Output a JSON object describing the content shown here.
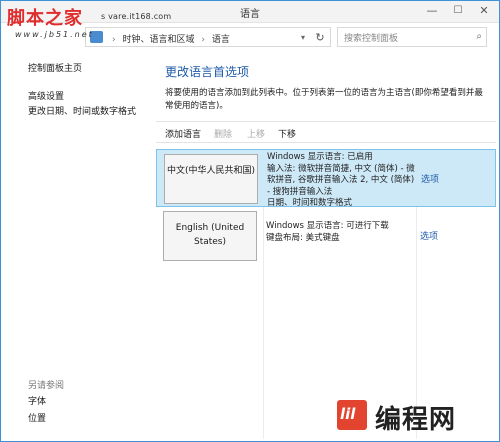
{
  "window": {
    "title": "语言",
    "title_extra": "s    vare.it168.com",
    "controls": {
      "minimize": "—",
      "maximize": "☐",
      "close": "✕"
    }
  },
  "watermark": {
    "main_text": "脚本之家",
    "url_text": "www.jb51.net",
    "color": "#e02d2d"
  },
  "address_bar": {
    "crumbs": [
      "时钟、语言和区域",
      "语言"
    ],
    "separator": "›",
    "dropdown_icon": "chevron-down-icon",
    "refresh_glyph": "↻"
  },
  "search": {
    "placeholder": "搜索控制面板",
    "icon_glyph": "⌕"
  },
  "sidebar": {
    "home": "控制面板主页",
    "items": [
      {
        "label": "高级设置"
      },
      {
        "label": "更改日期、时间或数字格式"
      }
    ],
    "see_also_title": "另请参阅",
    "see_also_items": [
      {
        "label": "字体"
      },
      {
        "label": "位置"
      }
    ]
  },
  "main": {
    "title": "更改语言首选项",
    "description": "将要使用的语言添加到此列表中。位于列表第一位的语言为主语言(即你希望看到并最常使用的语言)。",
    "toolbar": {
      "add": "添加语言",
      "remove": "删除",
      "up": "上移",
      "down": "下移"
    },
    "languages": [
      {
        "name": "中文(中华人民共和国)",
        "info": "Windows 显示语言: 已启用\n输入法: 微软拼音简捷, 中文 (简体) - 微软拼音, 谷歌拼音输入法 2, 中文 (简体) - 搜狗拼音输入法\n日期、时间和数字格式",
        "options": "选项",
        "selected": true
      },
      {
        "name": "English (United States)",
        "info": "Windows 显示语言: 可进行下载\n键盘布局: 美式键盘",
        "options": "选项",
        "selected": false
      }
    ]
  },
  "logo": {
    "mark_text": "lil",
    "text": "编程网",
    "accent": "#e24430"
  },
  "colors": {
    "accent": "#1d5aa8",
    "selected_row_bg": "#cde8f7",
    "selected_row_border": "#7bc3e8"
  }
}
